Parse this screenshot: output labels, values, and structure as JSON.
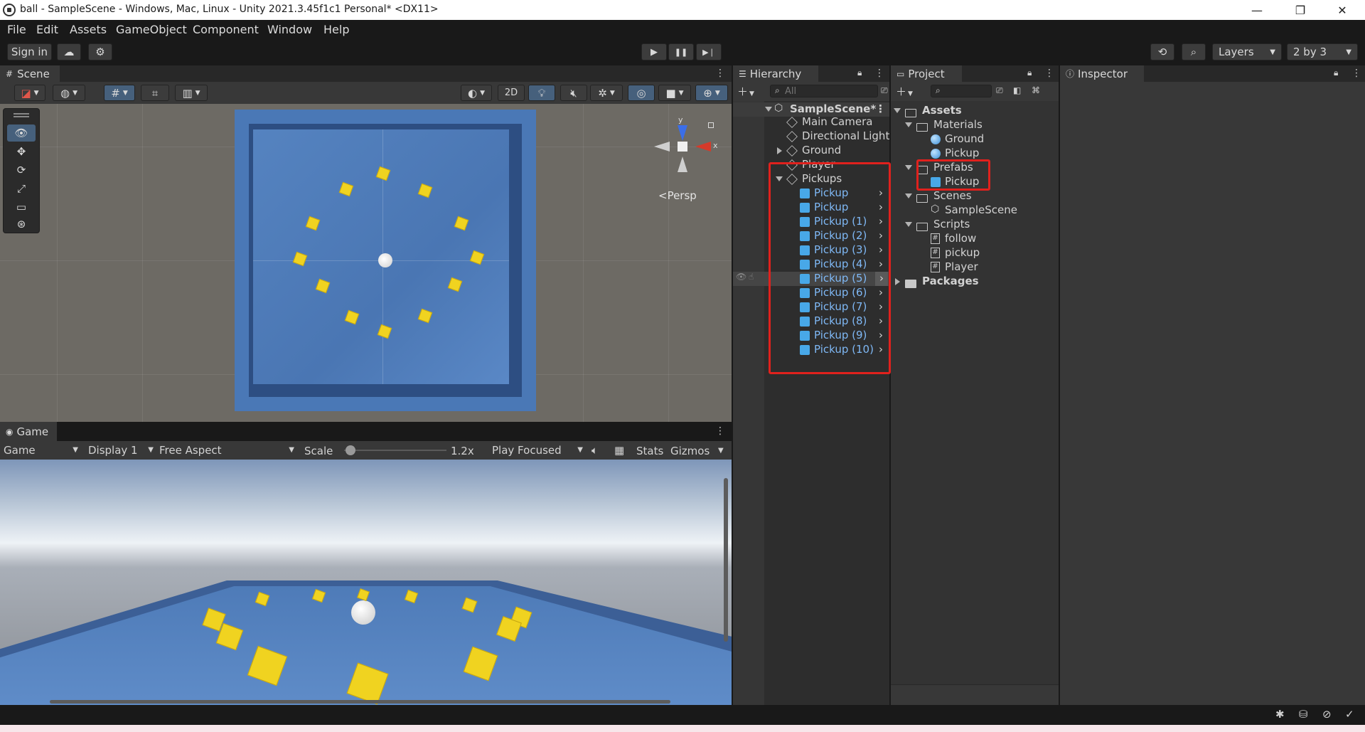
{
  "window": {
    "title": "ball - SampleScene - Windows, Mac, Linux - Unity 2021.3.45f1c1 Personal* <DX11>",
    "minimize": "—",
    "restore": "❐",
    "close": "✕"
  },
  "menu": [
    "File",
    "Edit",
    "Assets",
    "GameObject",
    "Component",
    "Window",
    "Help"
  ],
  "toolbar": {
    "sign_in": "Sign in",
    "play": "▶",
    "pause": "❚❚",
    "step": "▶❘",
    "layers": "Layers",
    "layout": "2 by 3"
  },
  "scene": {
    "tab_label": "Scene",
    "mode_2d": "2D",
    "persp_label": "<Persp",
    "gizmo_y": "y",
    "gizmo_x": "x"
  },
  "game": {
    "tab_label": "Game",
    "view_select": "Game",
    "display_select": "Display 1",
    "aspect_select": "Free Aspect",
    "scale_label": "Scale",
    "scale_value": "1.2x",
    "scale_fraction": 0.06,
    "play_focus_select": "Play Focused",
    "stats_label": "Stats",
    "gizmos_label": "Gizmos"
  },
  "hierarchy": {
    "tab_label": "Hierarchy",
    "search_placeholder": "All",
    "scene_name": "SampleScene*",
    "items": [
      "Main Camera",
      "Directional Light",
      "Ground",
      "Player",
      "Pickups"
    ],
    "pickups": [
      "Pickup",
      "Pickup",
      "Pickup (1)",
      "Pickup (2)",
      "Pickup (3)",
      "Pickup (4)",
      "Pickup (5)",
      "Pickup (6)",
      "Pickup (7)",
      "Pickup (8)",
      "Pickup (9)",
      "Pickup (10)"
    ]
  },
  "project": {
    "tab_label": "Project",
    "assets": "Assets",
    "materials": "Materials",
    "material_items": [
      "Ground",
      "Pickup"
    ],
    "prefabs": "Prefabs",
    "prefab_items": [
      "Pickup"
    ],
    "scenes": "Scenes",
    "scene_items": [
      "SampleScene"
    ],
    "scripts": "Scripts",
    "script_items": [
      "follow",
      "pickup",
      "Player"
    ],
    "packages": "Packages"
  },
  "inspector": {
    "tab_label": "Inspector"
  },
  "colors": {
    "accent_blue": "#4a6fa5",
    "prefab_text": "#7fb8f5",
    "highlight_red": "#e0211d",
    "pickup_yellow": "#f0d320"
  }
}
